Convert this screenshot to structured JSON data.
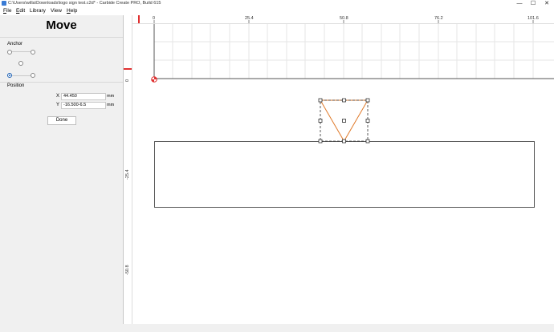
{
  "window": {
    "title": "C:\\Users\\willa\\Downloads\\logo sign test.c2d* - Carbide Create PRO, Build 615",
    "minimize_glyph": "—",
    "maximize_glyph": "☐",
    "close_glyph": "✕"
  },
  "menu": [
    {
      "underline": "F",
      "rest": "ile"
    },
    {
      "underline": "E",
      "rest": "dit"
    },
    {
      "underline": "",
      "rest": "Library"
    },
    {
      "underline": "",
      "rest": "View"
    },
    {
      "underline": "H",
      "rest": "elp"
    }
  ],
  "panel": {
    "title": "Move",
    "anchor_label": "Anchor",
    "anchor_selected": "bottom-left",
    "position_label": "Position",
    "x_label": "X",
    "x_value": "44.450",
    "x_unit": "mm",
    "y_label": "Y",
    "y_value": "-16.500-6.5",
    "y_unit": "mm",
    "done_label": "Done"
  },
  "rulers": {
    "h_labels": [
      "0",
      "25.4",
      "50.8",
      "76.2",
      "101.6"
    ],
    "v_labels": [
      "0",
      "-25.4",
      "-50.8"
    ]
  },
  "colors": {
    "accent_red": "#e03030",
    "selection_stroke": "#e07a2a",
    "shape_stroke": "#555555",
    "grid": "#e6e6e6"
  }
}
